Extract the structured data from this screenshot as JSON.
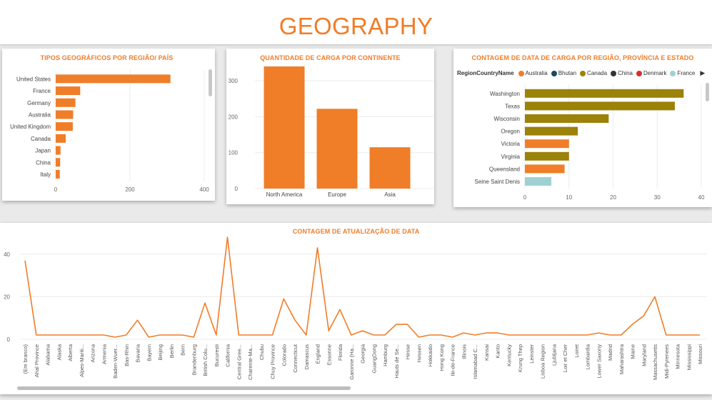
{
  "page": {
    "title": "GEOGRAPHY"
  },
  "colors": {
    "accent": "#f07d28",
    "olive": "#9b8208",
    "teal": "#9fd1d3",
    "grid": "#ececec",
    "axis_text": "#666666"
  },
  "chart_data": [
    {
      "id": "geo-types",
      "type": "bar",
      "orientation": "horizontal",
      "title": "TIPOS GEOGRÁFICOS POR REGIÃO/ PAÍS",
      "categories": [
        "United States",
        "France",
        "Germany",
        "Australia",
        "United Kingdom",
        "Canada",
        "Japan",
        "China",
        "Italy"
      ],
      "values": [
        309,
        66,
        53,
        47,
        46,
        27,
        13,
        12,
        11
      ],
      "x_ticks": [
        0,
        200,
        400
      ],
      "xlim": [
        0,
        400
      ],
      "grid": true,
      "color": "#f07d28"
    },
    {
      "id": "cargo-continent",
      "type": "bar",
      "orientation": "vertical",
      "title": "QUANTIDADE DE CARGA POR CONTINENTE",
      "categories": [
        "North America",
        "Europe",
        "Asia"
      ],
      "values": [
        340,
        222,
        115
      ],
      "y_ticks": [
        0,
        100,
        200,
        300
      ],
      "ylim": [
        0,
        350
      ],
      "grid": true,
      "color": "#f07d28"
    },
    {
      "id": "cargo-region",
      "type": "bar",
      "orientation": "horizontal",
      "title": "CONTAGEM DE DATA DE CARGA POR REGIÃO, PROVÍNCIA E ESTADO",
      "legend": {
        "title": "RegionCountryName",
        "position": "top-left",
        "items": [
          {
            "name": "Australia",
            "color": "#f07d28"
          },
          {
            "name": "Bhutan",
            "color": "#1a4a5c"
          },
          {
            "name": "Canada",
            "color": "#9b8208"
          },
          {
            "name": "China",
            "color": "#333333"
          },
          {
            "name": "Denmark",
            "color": "#d62f2f"
          },
          {
            "name": "France",
            "color": "#9fd1d3"
          }
        ]
      },
      "categories": [
        "Washington",
        "Texas",
        "Wisconsin",
        "Oregon",
        "Victoria",
        "Virginia",
        "Queensland",
        "Seine Saint Denis"
      ],
      "values": [
        36,
        34,
        19,
        12,
        10,
        10,
        9,
        6
      ],
      "colors": [
        "#9b8208",
        "#9b8208",
        "#9b8208",
        "#9b8208",
        "#f07d28",
        "#9b8208",
        "#f07d28",
        "#9fd1d3"
      ],
      "x_ticks": [
        0,
        10,
        20,
        30,
        40
      ],
      "xlim": [
        0,
        40
      ],
      "grid": true
    },
    {
      "id": "update-count",
      "type": "line",
      "title": "CONTAGEM DE ATUALIZAÇÃO DE DATA",
      "x": [
        "(Em branco)",
        "Ahal Province",
        "Alabama",
        "Alaska",
        "Alberta",
        "Alpes-Mariti...",
        "Arizona",
        "Armenia",
        "Baden-Wuer...",
        "Bas-Rhin",
        "Bavaria",
        "Bayern",
        "Beijing",
        "Berlin",
        "Bern",
        "Brandenburg",
        "British Colu...",
        "Bucuresti",
        "California",
        "Central Gree...",
        "Charente-Ma...",
        "Chubu",
        "Chuy Province",
        "Colorado",
        "Connecticut",
        "Damascus",
        "England",
        "Essonne",
        "Florida",
        "Garonne (Ha...",
        "Georgia",
        "GuangDong",
        "Hamburg",
        "Hauts de Se...",
        "Hesse",
        "Hessen",
        "Hokkaido",
        "Hong Kong",
        "Ile-de-France",
        "Illinois",
        "Islamabad C...",
        "Kansai",
        "Kanto",
        "Kentucky",
        "Krung Thep",
        "Leinster",
        "Lisboa Region",
        "Ljubljana",
        "Loir et Cher",
        "Loiret",
        "Lombardia",
        "Lower Saxony",
        "Madrid",
        "Maharashtra",
        "Maine",
        "Maryland",
        "Massachusetts",
        "Midi-Pyrenees",
        "Minnesota",
        "Mississippi",
        "Missouri"
      ],
      "y": [
        37,
        2,
        2,
        2,
        2,
        2,
        2,
        2,
        1,
        2,
        9,
        1,
        2,
        2,
        2,
        1,
        17,
        2,
        48,
        2,
        2,
        2,
        2,
        19,
        9,
        2,
        43,
        4,
        14,
        2,
        4,
        2,
        2,
        7,
        7,
        1,
        2,
        2,
        1,
        3,
        2,
        3,
        3,
        2,
        2,
        2,
        2,
        2,
        2,
        2,
        2,
        3,
        2,
        2,
        7,
        11,
        20,
        2,
        2,
        2,
        2
      ],
      "y_ticks": [
        0,
        20,
        40
      ],
      "ylim": [
        0,
        50
      ],
      "grid": true,
      "color": "#f07d28"
    }
  ]
}
